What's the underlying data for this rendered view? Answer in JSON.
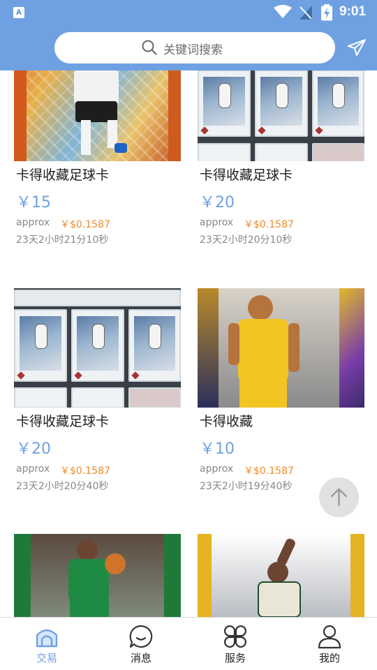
{
  "status_bar": {
    "app_badge": "A",
    "time": "9:01",
    "icons": [
      "app-notification-icon",
      "wifi-icon",
      "no-signal-icon",
      "battery-charging-icon"
    ]
  },
  "search": {
    "placeholder": "关键词搜索",
    "icon": "search-icon"
  },
  "header_action": {
    "icon": "send-icon"
  },
  "items": [
    {
      "title": "卡得收藏足球卡",
      "price": "￥15",
      "approx_label": "approx",
      "usd_price": "￥$0.1587",
      "countdown": "23天2小时21分10秒",
      "image": "soccer-player-card"
    },
    {
      "title": "卡得收藏足球卡",
      "price": "￥20",
      "approx_label": "approx",
      "usd_price": "￥$0.1587",
      "countdown": "23天2小时20分10秒",
      "image": "graded-card-slabs"
    },
    {
      "title": "卡得收藏足球卡",
      "price": "￥20",
      "approx_label": "approx",
      "usd_price": "￥$0.1587",
      "countdown": "23天2小时20分40秒",
      "image": "graded-card-slabs"
    },
    {
      "title": "卡得收藏",
      "price": "￥10",
      "approx_label": "approx",
      "usd_price": "￥$0.1587",
      "countdown": "23天2小时19分40秒",
      "image": "basketball-pacers-card"
    },
    {
      "title": "",
      "price": "",
      "approx_label": "",
      "usd_price": "",
      "countdown": "",
      "image": "basketball-celtics-card"
    },
    {
      "title": "",
      "price": "",
      "approx_label": "",
      "usd_price": "",
      "countdown": "",
      "image": "basketball-bucks-card"
    }
  ],
  "scroll_top": {
    "icon": "arrow-up-icon"
  },
  "bottom_nav": [
    {
      "label": "交易",
      "icon": "trade-icon",
      "active": true
    },
    {
      "label": "消息",
      "icon": "message-icon",
      "active": false
    },
    {
      "label": "服务",
      "icon": "services-icon",
      "active": false
    },
    {
      "label": "我的",
      "icon": "profile-icon",
      "active": false
    }
  ],
  "colors": {
    "accent": "#6fa1e2",
    "price_orange": "#f08a2b",
    "muted_text": "#888888"
  }
}
